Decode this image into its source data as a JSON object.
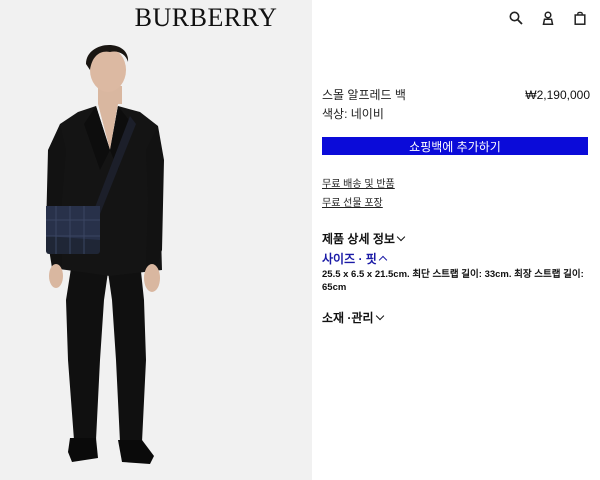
{
  "header": {
    "logo": "BURBERRY",
    "icons": [
      "search-icon",
      "account-icon",
      "bag-icon"
    ]
  },
  "product": {
    "name": "스몰 알프레드 백",
    "price": "₩2,190,000",
    "color_label": "색상: 네이비",
    "add_to_bag": "쇼핑백에 추가하기"
  },
  "links": {
    "shipping": "무료 배송 및 반품",
    "gift": "무료 선물 포장"
  },
  "sections": {
    "details": "제품 상세 정보",
    "size_fit": "사이즈 · 핏",
    "size_text": "25.5 x 6.5 x 21.5cm. 최단 스트랩 길이: 33cm. 최장 스트랩 길이: 65cm",
    "material": "소재 ·관리"
  },
  "colors": {
    "accent_button": "#0b0bd9",
    "size_link": "#1a1aa6",
    "image_bg": "#f1f1f1"
  }
}
